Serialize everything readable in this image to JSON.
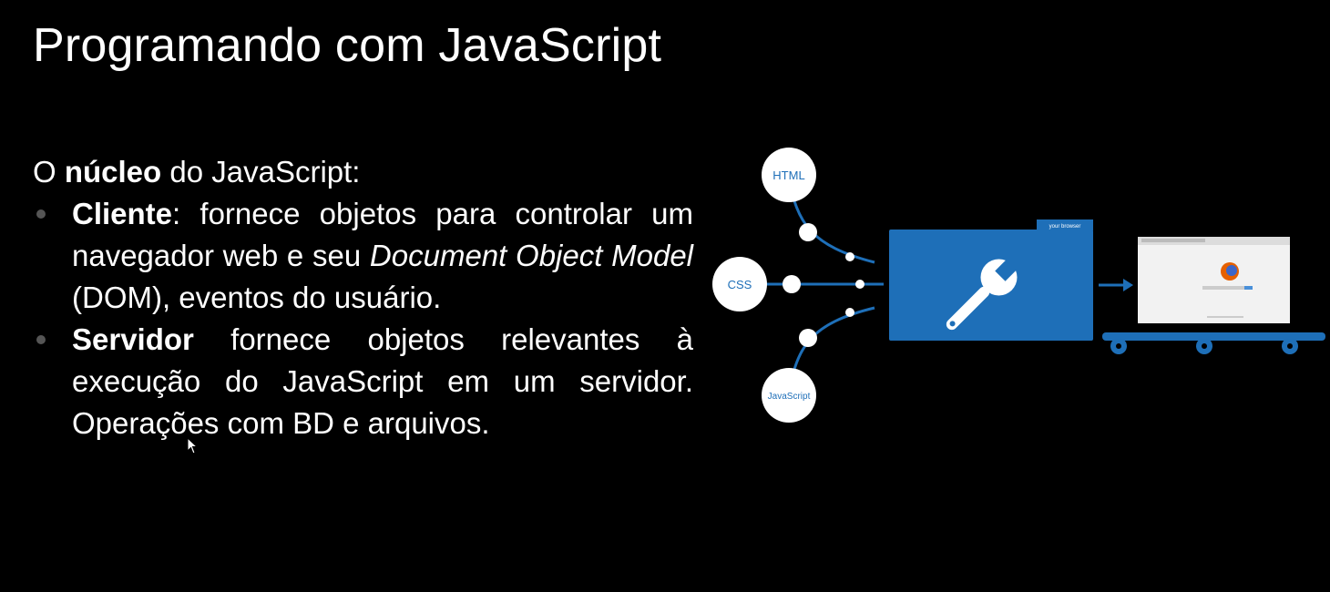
{
  "slide": {
    "title": "Programando com JavaScript",
    "intro_prefix": "O ",
    "intro_bold": "núcleo",
    "intro_suffix": " do JavaScript:",
    "bullets": [
      {
        "bold": "Cliente",
        "text_before_italic": ": fornece objetos para controlar um navegador web e seu ",
        "italic": "Document Object Model",
        "text_after_italic": " (DOM), eventos do usuário."
      },
      {
        "bold": "Servidor",
        "text": " fornece objetos relevantes à execução do JavaScript em um servidor. Operações com BD e arquivos."
      }
    ]
  },
  "diagram": {
    "nodes": {
      "html": "HTML",
      "css": "CSS",
      "javascript": "JavaScript"
    },
    "browser_tab_label": "your browser",
    "icons": [
      "wrench-icon",
      "firefox-icon"
    ],
    "colors": {
      "accent": "#1e6fb8",
      "node_fill": "#ffffff",
      "line": "#1e6fb8"
    }
  }
}
